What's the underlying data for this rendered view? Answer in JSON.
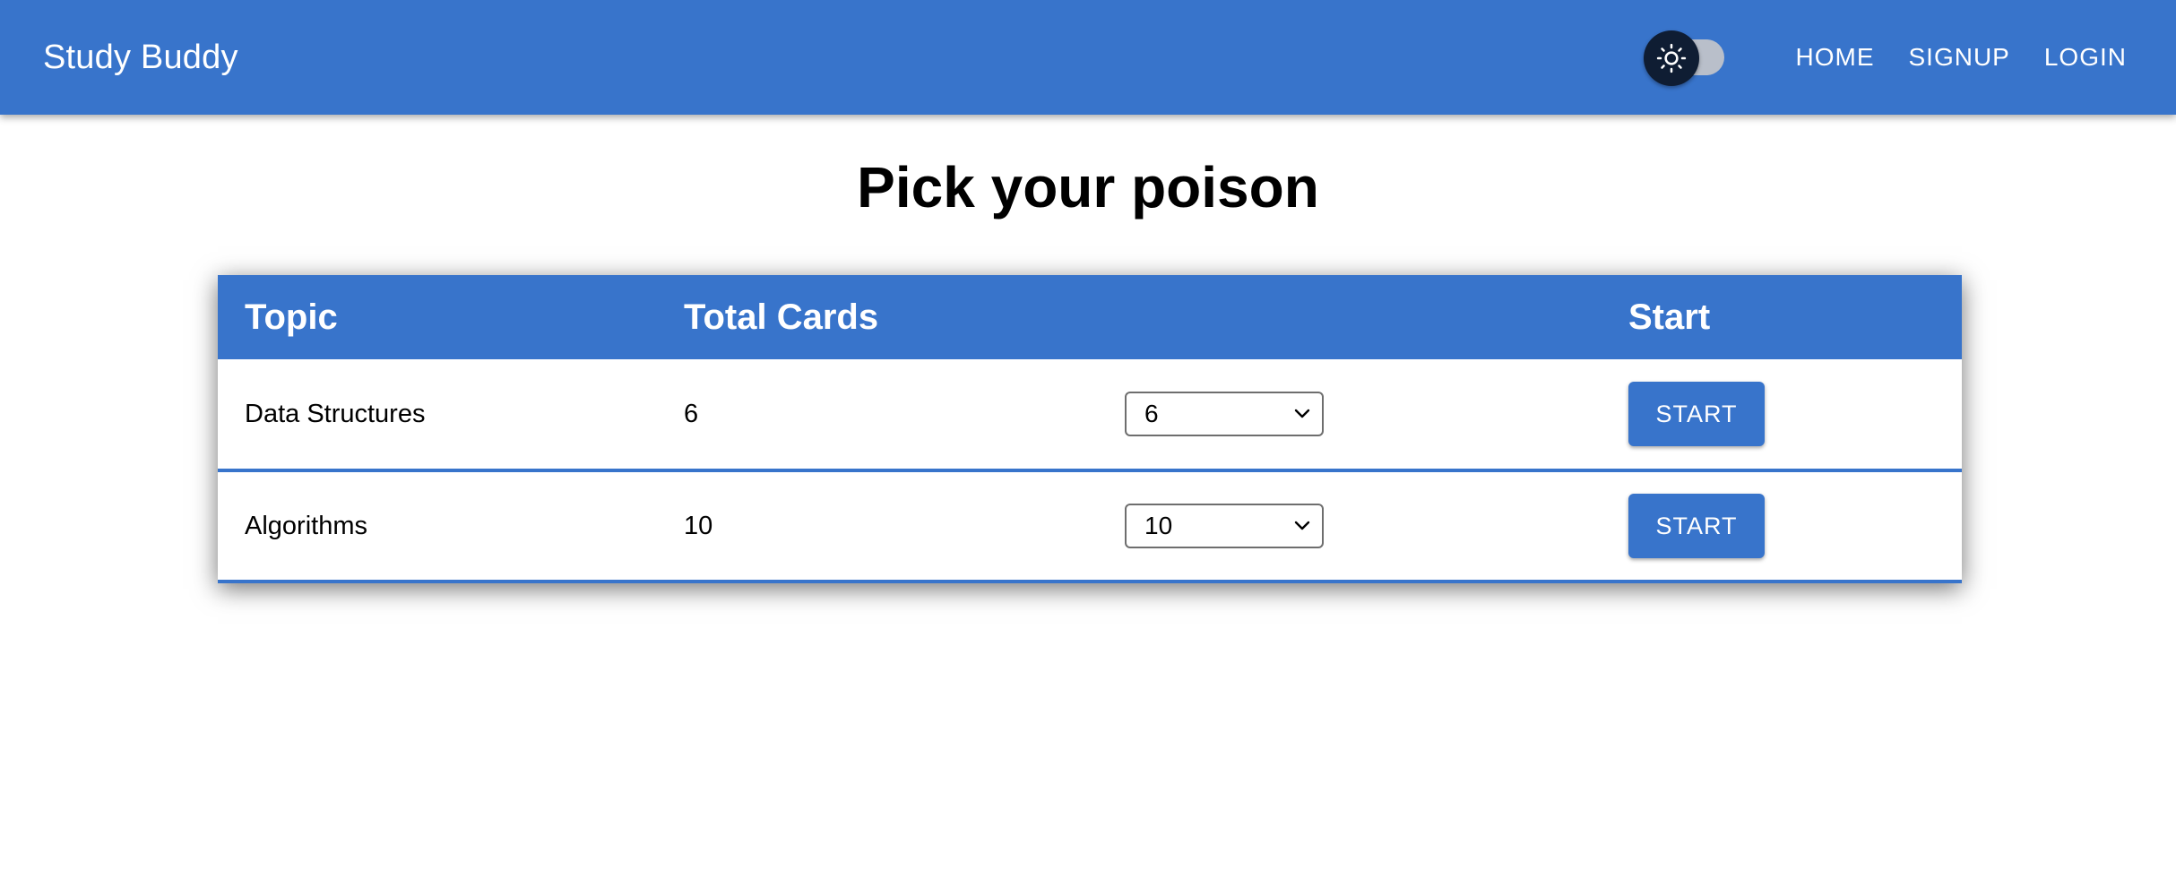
{
  "header": {
    "brand": "Study Buddy",
    "theme_toggle_icon": "sun-icon",
    "nav": [
      {
        "label": "HOME"
      },
      {
        "label": "SIGNUP"
      },
      {
        "label": "LOGIN"
      }
    ]
  },
  "main": {
    "title": "Pick your poison",
    "table": {
      "headers": {
        "topic": "Topic",
        "total": "Total Cards",
        "select": "",
        "start": "Start"
      },
      "rows": [
        {
          "topic": "Data Structures",
          "total": "6",
          "selected": "6",
          "start_label": "START"
        },
        {
          "topic": "Algorithms",
          "total": "10",
          "selected": "10",
          "start_label": "START"
        }
      ]
    }
  },
  "colors": {
    "primary": "#3874cb",
    "toggle_thumb": "#0f1d33",
    "toggle_track": "#b9bfca"
  }
}
